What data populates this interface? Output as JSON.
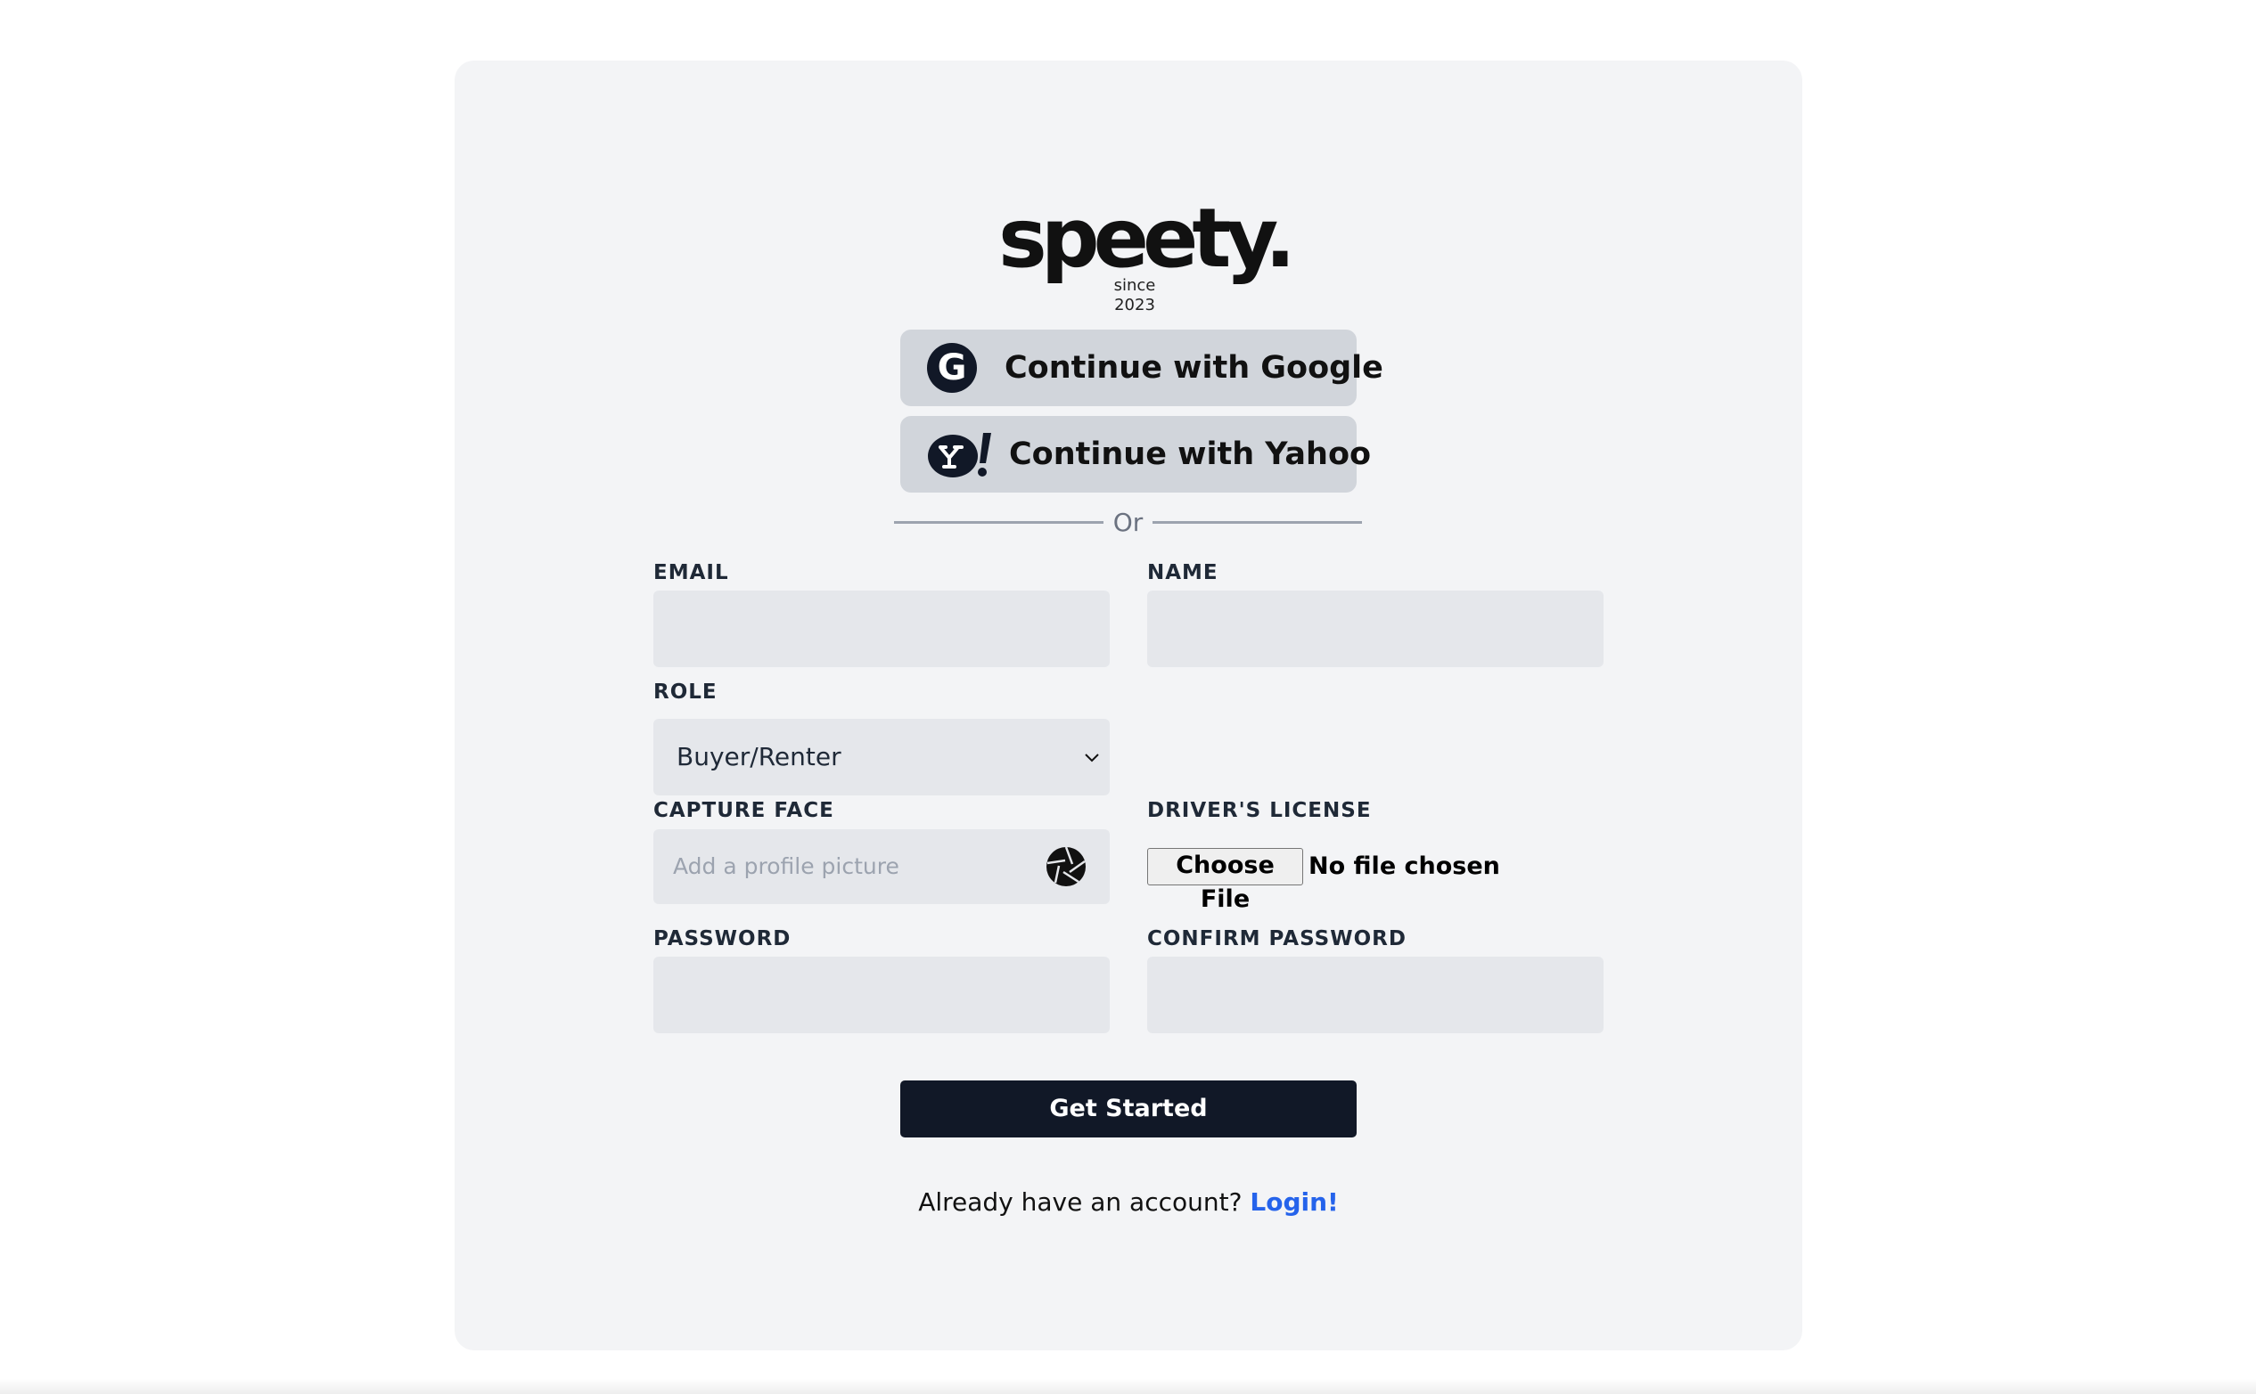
{
  "logo": {
    "wordmark": "speety.",
    "since": "since",
    "year": "2023"
  },
  "oauth": {
    "google_icon": "G",
    "google_label": "Continue with Google",
    "yahoo_label": "Continue with Yahoo"
  },
  "divider_text": "Or",
  "form": {
    "email_label": "EMAIL",
    "email_value": "",
    "name_label": "NAME",
    "name_value": "",
    "role_label": "ROLE",
    "role_value": "Buyer/Renter",
    "capture_label": "CAPTURE FACE",
    "capture_placeholder": "Add a profile picture",
    "license_label": "DRIVER'S LICENSE",
    "file_button": "Choose File",
    "file_status": "No file chosen",
    "password_label": "PASSWORD",
    "password_value": "",
    "confirm_label": "CONFIRM PASSWORD",
    "confirm_value": ""
  },
  "submit_label": "Get Started",
  "footer": {
    "prompt": "Already have an account?",
    "login_link": "Login!"
  },
  "colors": {
    "card_bg": "#f3f4f6",
    "input_bg": "#e5e7eb",
    "button_gray": "#d1d5db",
    "primary": "#111827",
    "link": "#2563eb"
  },
  "icons": {
    "google": "google-icon",
    "yahoo": "yahoo-icon",
    "chevron": "chevron-down-icon",
    "aperture": "camera-aperture-icon"
  }
}
